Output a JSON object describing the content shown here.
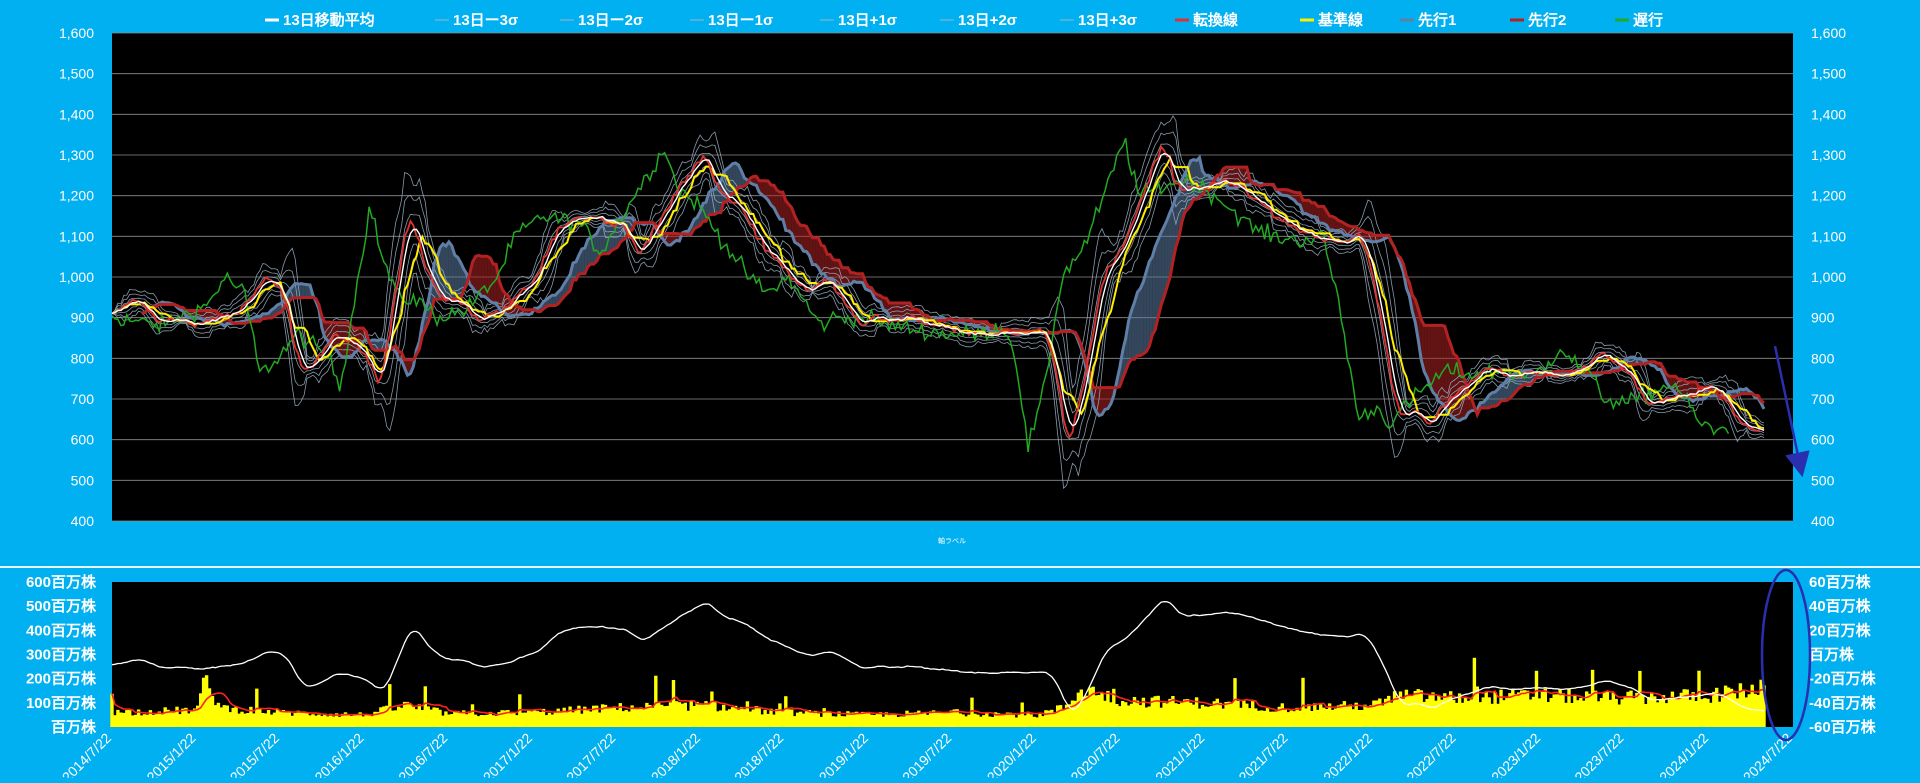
{
  "colors": {
    "background": "#00b0f0",
    "plot_bg": "#000000",
    "text": "#ffffff",
    "ma": "#ffffff",
    "sigma": "#9fb4c8",
    "tenkan": "#e03030",
    "kijun": "#ffee00",
    "senkou1": "#5f7fa6",
    "senkou2": "#b22222",
    "chikou": "#22aa22",
    "volume": "#ffff00",
    "volume_ma": "#ff2020",
    "annotation": "#2a2fb0"
  },
  "chart_data": [
    {
      "type": "line",
      "legend_placement": "top",
      "legend": [
        {
          "name": "13日移動平均",
          "color_key": "ma"
        },
        {
          "name": "13日ー3σ",
          "color_key": "sigma"
        },
        {
          "name": "13日ー2σ",
          "color_key": "sigma"
        },
        {
          "name": "13日ー1σ",
          "color_key": "sigma"
        },
        {
          "name": "13日+1σ",
          "color_key": "sigma"
        },
        {
          "name": "13日+2σ",
          "color_key": "sigma"
        },
        {
          "name": "13日+3σ",
          "color_key": "sigma"
        },
        {
          "name": "転換線",
          "color_key": "tenkan"
        },
        {
          "name": "基準線",
          "color_key": "kijun"
        },
        {
          "name": "先行1",
          "color_key": "senkou1"
        },
        {
          "name": "先行2",
          "color_key": "senkou2"
        },
        {
          "name": "遅行",
          "color_key": "chikou"
        }
      ],
      "ylim": [
        400,
        1600
      ],
      "y_ticks": [
        "400",
        "500",
        "600",
        "700",
        "800",
        "900",
        "1,000",
        "1,100",
        "1,200",
        "1,300",
        "1,400",
        "1,500",
        "1,600"
      ],
      "y_ticks_right": [
        "400",
        "500",
        "600",
        "700",
        "800",
        "900",
        "1,000",
        "1,100",
        "1,200",
        "1,300",
        "1,400",
        "1,500",
        "1,600"
      ],
      "grid": true,
      "xlabel": "軸ラベル",
      "x_dates": [
        "2014/7/22",
        "2015/1/22",
        "2015/7/22",
        "2016/1/22",
        "2016/7/22",
        "2017/1/22",
        "2017/7/22",
        "2018/1/22",
        "2018/7/22",
        "2019/1/22",
        "2019/7/22",
        "2020/1/22",
        "2020/7/22",
        "2021/1/22",
        "2021/7/22",
        "2022/1/22",
        "2022/7/22",
        "2023/1/22",
        "2023/7/22",
        "2024/1/22",
        "2024/7/22"
      ],
      "price_keypoints": [
        [
          "2014/7/22",
          900
        ],
        [
          "2014/9/1",
          950
        ],
        [
          "2014/10/15",
          900
        ],
        [
          "2014/12/1",
          890
        ],
        [
          "2015/1/22",
          880
        ],
        [
          "2015/3/1",
          900
        ],
        [
          "2015/5/1",
          930
        ],
        [
          "2015/6/10",
          1000
        ],
        [
          "2015/7/22",
          960
        ],
        [
          "2015/8/25",
          760
        ],
        [
          "2015/10/1",
          800
        ],
        [
          "2015/11/15",
          860
        ],
        [
          "2016/1/22",
          800
        ],
        [
          "2016/2/15",
          730
        ],
        [
          "2016/3/15",
          930
        ],
        [
          "2016/4/20",
          1180
        ],
        [
          "2016/5/15",
          1050
        ],
        [
          "2016/6/24",
          940
        ],
        [
          "2016/7/22",
          950
        ],
        [
          "2016/9/15",
          900
        ],
        [
          "2016/11/15",
          920
        ],
        [
          "2017/1/22",
          1000
        ],
        [
          "2017/3/1",
          1100
        ],
        [
          "2017/5/1",
          1150
        ],
        [
          "2017/7/22",
          1130
        ],
        [
          "2017/9/1",
          1060
        ],
        [
          "2017/11/15",
          1200
        ],
        [
          "2018/1/22",
          1320
        ],
        [
          "2018/2/15",
          1220
        ],
        [
          "2018/4/1",
          1180
        ],
        [
          "2018/6/1",
          1080
        ],
        [
          "2018/7/22",
          1000
        ],
        [
          "2018/9/1",
          960
        ],
        [
          "2018/10/15",
          1000
        ],
        [
          "2018/12/25",
          880
        ],
        [
          "2019/1/22",
          900
        ],
        [
          "2019/4/1",
          900
        ],
        [
          "2019/6/1",
          880
        ],
        [
          "2019/7/22",
          870
        ],
        [
          "2019/10/1",
          860
        ],
        [
          "2019/12/15",
          860
        ],
        [
          "2020/1/22",
          880
        ],
        [
          "2020/2/20",
          820
        ],
        [
          "2020/3/19",
          580
        ],
        [
          "2020/4/20",
          700
        ],
        [
          "2020/6/1",
          1000
        ],
        [
          "2020/7/22",
          1080
        ],
        [
          "2020/9/1",
          1200
        ],
        [
          "2020/10/15",
          1340
        ],
        [
          "2020/11/15",
          1200
        ],
        [
          "2021/1/22",
          1230
        ],
        [
          "2021/3/1",
          1240
        ],
        [
          "2021/5/1",
          1200
        ],
        [
          "2021/7/22",
          1120
        ],
        [
          "2021/9/1",
          1100
        ],
        [
          "2021/11/1",
          1090
        ],
        [
          "2021/12/20",
          1100
        ],
        [
          "2022/1/22",
          950
        ],
        [
          "2022/3/8",
          650
        ],
        [
          "2022/4/15",
          680
        ],
        [
          "2022/5/15",
          640
        ],
        [
          "2022/7/22",
          720
        ],
        [
          "2022/9/15",
          770
        ],
        [
          "2022/11/15",
          760
        ],
        [
          "2023/1/22",
          770
        ],
        [
          "2023/3/10",
          750
        ],
        [
          "2023/4/20",
          780
        ],
        [
          "2023/5/20",
          830
        ],
        [
          "2023/6/20",
          790
        ],
        [
          "2023/7/22",
          760
        ],
        [
          "2023/8/25",
          700
        ],
        [
          "2023/10/15",
          690
        ],
        [
          "2023/12/15",
          720
        ],
        [
          "2024/1/22",
          740
        ],
        [
          "2024/2/20",
          690
        ],
        [
          "2024/3/20",
          640
        ],
        [
          "2024/4/20",
          620
        ],
        [
          "2024/5/20",
          630
        ]
      ]
    },
    {
      "type": "bar",
      "y_ticks_left": [
        "百万株",
        "100百万株",
        "200百万株",
        "300百万株",
        "400百万株",
        "500百万株",
        "600百万株"
      ],
      "ylim_left": [
        0,
        600
      ],
      "y_ticks_right": [
        "-60百万株",
        "-40百万株",
        "-20百万株",
        "百万株",
        "20百万株",
        "40百万株",
        "60百万株"
      ],
      "ylim_right": [
        -60,
        60
      ],
      "grid": false,
      "x_tick_labels": [
        "2014/7/22",
        "2015/1/22",
        "2015/7/22",
        "2016/1/22",
        "2016/7/22",
        "2017/1/22",
        "2017/7/22",
        "2018/1/22",
        "2018/7/22",
        "2019/1/22",
        "2019/7/22",
        "2020/1/22",
        "2020/7/22",
        "2021/1/22",
        "2021/7/22",
        "2022/1/22",
        "2022/7/22",
        "2023/1/22",
        "2023/7/22",
        "2024/1/22",
        "2024/7/22"
      ],
      "volume_keypoints": [
        [
          "2014/7/22",
          60
        ],
        [
          "2015/1/22",
          70
        ],
        [
          "2015/2/10",
          190
        ],
        [
          "2015/3/15",
          80
        ],
        [
          "2015/7/22",
          60
        ],
        [
          "2016/1/22",
          50
        ],
        [
          "2016/4/20",
          90
        ],
        [
          "2016/7/22",
          55
        ],
        [
          "2017/1/22",
          60
        ],
        [
          "2017/7/22",
          80
        ],
        [
          "2018/1/22",
          90
        ],
        [
          "2018/7/22",
          60
        ],
        [
          "2019/1/22",
          50
        ],
        [
          "2019/7/22",
          60
        ],
        [
          "2020/1/22",
          50
        ],
        [
          "2020/3/20",
          80
        ],
        [
          "2020/5/1",
          160
        ],
        [
          "2020/7/22",
          110
        ],
        [
          "2021/1/22",
          100
        ],
        [
          "2021/7/22",
          80
        ],
        [
          "2022/1/22",
          90
        ],
        [
          "2022/4/1",
          130
        ],
        [
          "2022/7/22",
          120
        ],
        [
          "2023/1/22",
          130
        ],
        [
          "2023/7/22",
          120
        ],
        [
          "2024/1/22",
          130
        ],
        [
          "2024/5/20",
          160
        ]
      ]
    }
  ]
}
